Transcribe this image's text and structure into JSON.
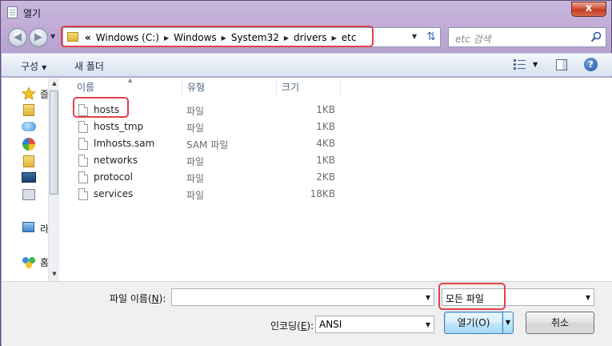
{
  "window": {
    "title": "열기",
    "close_glyph": "x"
  },
  "address": {
    "prefix": "«",
    "crumbs": [
      "Windows (C:)",
      "Windows",
      "System32",
      "drivers",
      "etc"
    ]
  },
  "search": {
    "placeholder": "etc 검색"
  },
  "toolbar": {
    "organize": "구성",
    "new_folder": "새 폴더"
  },
  "navpane": {
    "items": [
      "즐",
      "라",
      "홈"
    ]
  },
  "columns": {
    "name": "이름",
    "type": "유형",
    "size": "크기"
  },
  "files": [
    {
      "name": "hosts",
      "type": "파일",
      "size": "1KB"
    },
    {
      "name": "hosts_tmp",
      "type": "파일",
      "size": "1KB"
    },
    {
      "name": "lmhosts.sam",
      "type": "SAM 파일",
      "size": "4KB"
    },
    {
      "name": "networks",
      "type": "파일",
      "size": "1KB"
    },
    {
      "name": "protocol",
      "type": "파일",
      "size": "2KB"
    },
    {
      "name": "services",
      "type": "파일",
      "size": "18KB"
    }
  ],
  "bottom": {
    "filename_label_pre": "파일 이름(",
    "filename_label_key": "N",
    "filename_label_post": "):",
    "filename_value": "",
    "filter_value": "모든 파일",
    "encoding_label_pre": "인코딩(",
    "encoding_label_key": "E",
    "encoding_label_post": "):",
    "encoding_value": "ANSI",
    "open_label": "열기(O)",
    "cancel_label": "취소"
  },
  "colors": {
    "highlight": "#e0424a",
    "accent": "#3c7fb1",
    "frame": "#b49ccd"
  }
}
